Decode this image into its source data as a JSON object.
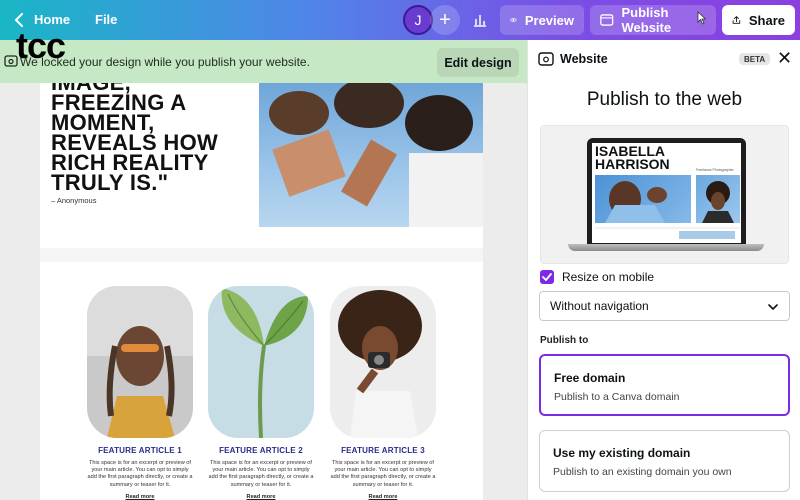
{
  "topbar": {
    "home_label": "Home",
    "file_label": "File",
    "avatar_initial": "J",
    "preview_label": "Preview",
    "publish_label": "Publish Website",
    "share_label": "Share"
  },
  "banner": {
    "text": "We locked your design while you publish your website.",
    "edit_label": "Edit design",
    "overlay_text": "tcc"
  },
  "canvas": {
    "quote": "IMAGE,\nFREEZING A\nMOMENT,\nREVEALS HOW\nRICH REALITY\nTRULY IS.\"",
    "author": "– Anonymous",
    "features": [
      {
        "title": "FEATURE ARTICLE 1",
        "body": "This space is for an excerpt or preview of your main article. You can opt to simply add the first paragraph directly, or create a summary or teaser for it.",
        "link": "Read more"
      },
      {
        "title": "FEATURE ARTICLE 2",
        "body": "This space is for an excerpt or preview of your main article. You can opt to simply add the first paragraph directly, or create a summary or teaser for it.",
        "link": "Read more"
      },
      {
        "title": "FEATURE ARTICLE 3",
        "body": "This space is for an excerpt or preview of your main article. You can opt to simply add the first paragraph directly, or create a summary or teaser for it.",
        "link": "Read more"
      }
    ]
  },
  "panel": {
    "title": "Website",
    "beta": "BETA",
    "heading": "Publish to the web",
    "preview_name": "ISABELLA\nHARRISON",
    "preview_tag": "Freelance Photographer",
    "resize_label": "Resize on mobile",
    "resize_checked": true,
    "navigation_value": "Without navigation",
    "publish_to_label": "Publish to",
    "options": [
      {
        "title": "Free domain",
        "desc": "Publish to a Canva domain",
        "selected": true
      },
      {
        "title": "Use my existing domain",
        "desc": "Publish to an existing domain you own",
        "selected": false
      }
    ]
  },
  "colors": {
    "accent": "#7d2ae8",
    "banner_bg": "#c7e8c4",
    "feature_title": "#2a2b8a"
  }
}
